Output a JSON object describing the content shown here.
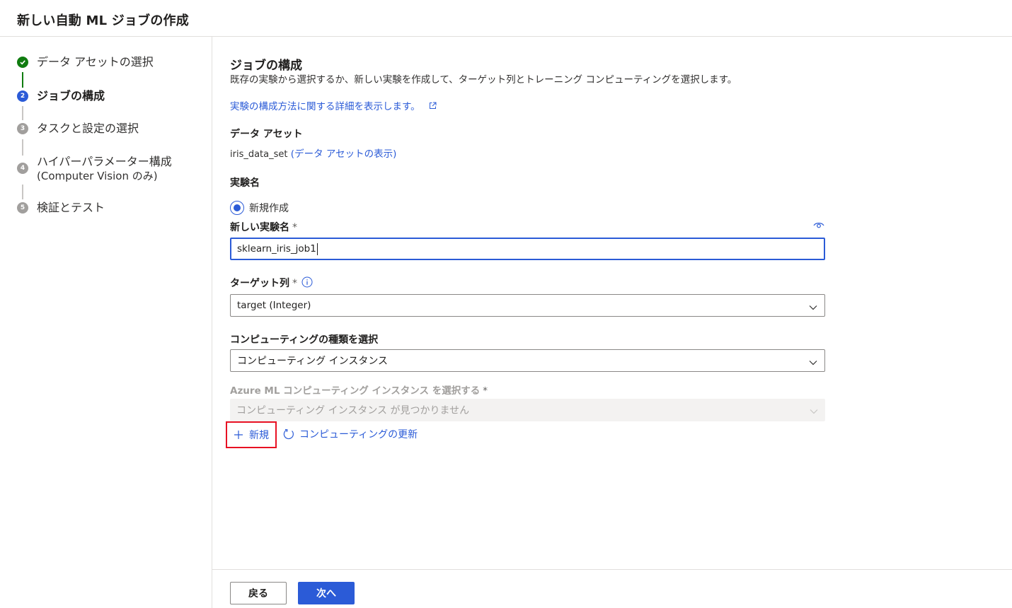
{
  "header": {
    "title": "新しい自動 ML ジョブの作成"
  },
  "steps": [
    {
      "num": "✓",
      "label": "データ アセットの選択",
      "state": "done"
    },
    {
      "num": "2",
      "label": "ジョブの構成",
      "state": "current"
    },
    {
      "num": "3",
      "label": "タスクと設定の選択",
      "state": "todo"
    },
    {
      "num": "4",
      "label_line1": "ハイパーパラメーター構成",
      "label_line2": "(Computer Vision のみ)",
      "state": "todo"
    },
    {
      "num": "5",
      "label": "検証とテスト",
      "state": "todo"
    }
  ],
  "main": {
    "title": "ジョブの構成",
    "description": "既存の実験から選択するか、新しい実験を作成して、ターゲット列とトレーニング コンピューティングを選択します。",
    "learn_more_link": "実験の構成方法に関する詳細を表示します。",
    "data_asset": {
      "label": "データ アセット",
      "value": "iris_data_set",
      "view_link": "(データ アセットの表示)"
    },
    "experiment": {
      "label": "実験名",
      "radio_label": "新規作成",
      "new_name_label": "新しい実験名",
      "required_marker": "*",
      "new_name_value": "sklearn_iris_job1"
    },
    "target_column": {
      "label": "ターゲット列",
      "required_marker": "*",
      "selected": "target (Integer)"
    },
    "compute_type": {
      "label": "コンピューティングの種類を選択",
      "selected": "コンピューティング インスタンス"
    },
    "compute_instance": {
      "label": "Azure ML コンピューティング インスタンス を選択する",
      "required_marker": "*",
      "placeholder": "コンピューティング インスタンス が見つかりません"
    },
    "actions": {
      "new_label": "新規",
      "refresh_label": "コンピューティングの更新"
    }
  },
  "footer": {
    "back_label": "戻る",
    "next_label": "次へ"
  },
  "colors": {
    "accent": "#2b5bd7",
    "success": "#107c10",
    "highlight": "#e81123"
  }
}
